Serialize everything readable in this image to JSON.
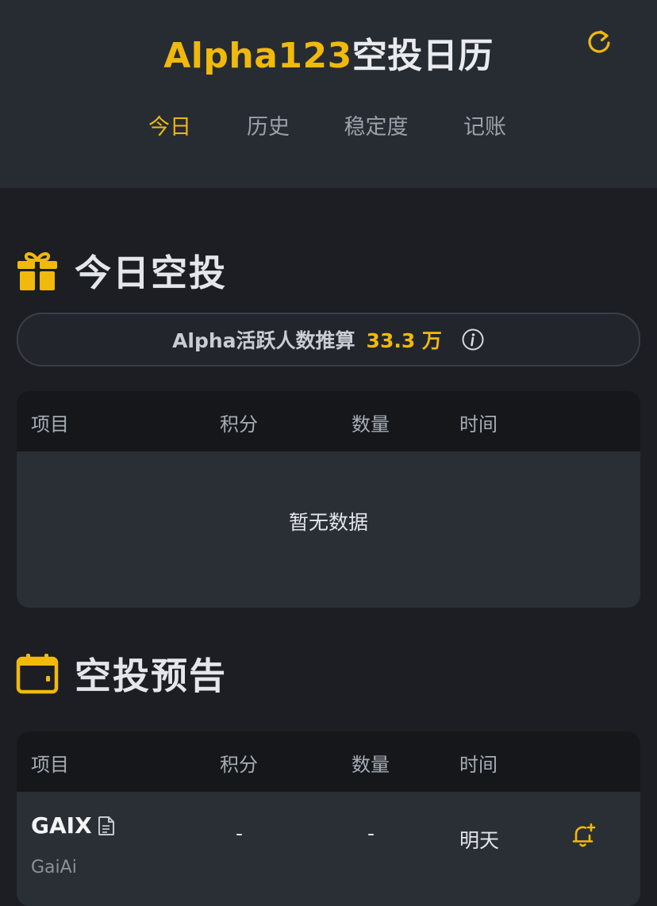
{
  "header": {
    "title_accent": "Alpha123",
    "title_rest": "空投日历",
    "tabs": [
      {
        "label": "今日"
      },
      {
        "label": "历史"
      },
      {
        "label": "稳定度"
      },
      {
        "label": "记账"
      }
    ]
  },
  "today": {
    "section_title": "今日空投",
    "active_users_label": "Alpha活跃人数推算",
    "active_users_value": "33.3 万",
    "table": {
      "headers": [
        "项目",
        "积分",
        "数量",
        "时间"
      ],
      "empty_text": "暂无数据"
    }
  },
  "preview": {
    "section_title": "空投预告",
    "table": {
      "headers": [
        "项目",
        "积分",
        "数量",
        "时间"
      ],
      "rows": [
        {
          "symbol": "GAIX",
          "name": "GaiAi",
          "points": "-",
          "amount": "-",
          "time": "明天"
        }
      ]
    }
  },
  "colors": {
    "accent": "#f0b90b",
    "background": "#1c1e23",
    "header": "#272c33",
    "card": "#2a2f36"
  },
  "icons": [
    "refresh-icon",
    "gift-icon",
    "info-icon",
    "calendar-icon",
    "document-icon",
    "bell-plus-icon"
  ]
}
